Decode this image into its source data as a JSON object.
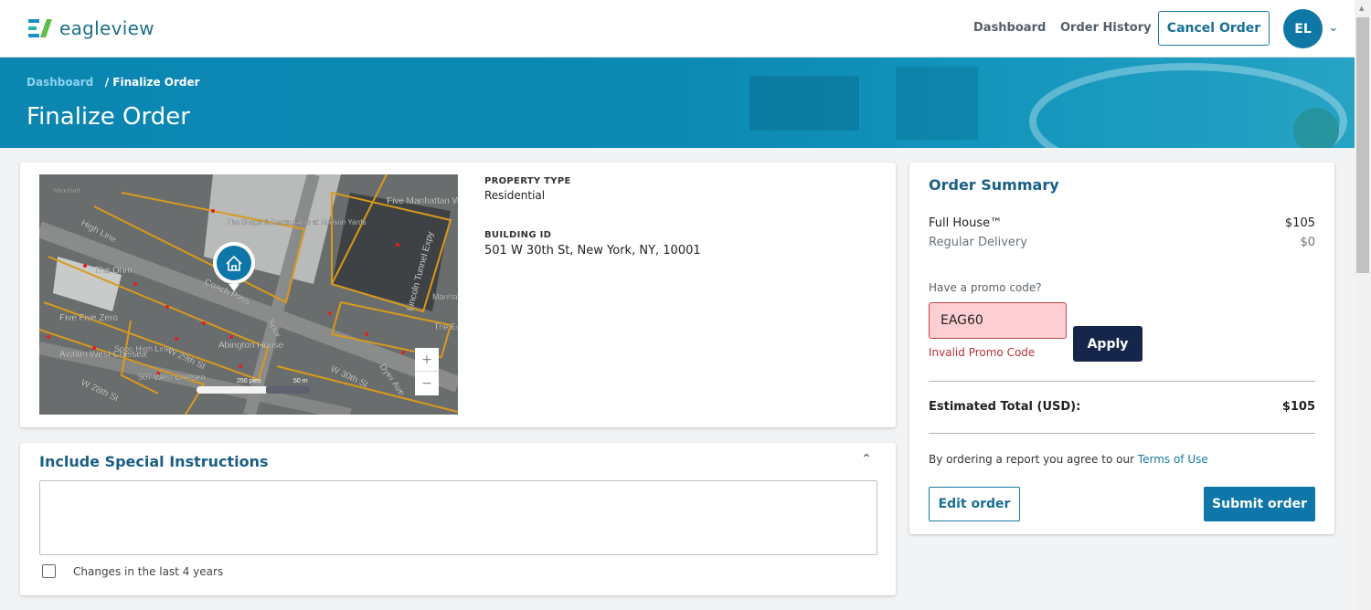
{
  "header": {
    "logo_text": "eagleview",
    "nav": [
      "Dashboard",
      "Order History"
    ],
    "cancel_label": "Cancel Order",
    "avatar_initials": "EL"
  },
  "banner": {
    "breadcrumb": {
      "root": "Dashboard",
      "current": "Finalize Order"
    },
    "title": "Finalize Order"
  },
  "property": {
    "type_label": "PROPERTY TYPE",
    "type_value": "Residential",
    "building_label": "BUILDING ID",
    "building_value": "501 W 30th St, New York, NY, 10001"
  },
  "map": {
    "labels": [
      "High Line",
      "The Shops & Restaurants at Hudson Yards",
      "Five Manhattan West",
      "The Ohm",
      "Coach Pass",
      "Spur",
      "Lincoln Tunnel Expy",
      "Five Five Zero",
      "Avalon West Chelsea",
      "Soori High Line",
      "W 29th St",
      "Abington House",
      "507 West Chelsea",
      "W 30th St",
      "Dyer Ave",
      "W 28th St",
      "Manhattan West",
      "The Eugene"
    ],
    "scale_feet": "250 pies",
    "scale_m": "50 m",
    "zoom_in": "+",
    "zoom_out": "−",
    "attribution": "Microsoft"
  },
  "instructions": {
    "title": "Include Special Instructions",
    "textarea_value": "",
    "checkbox_label": "Changes in the last 4 years",
    "checkbox_checked": false
  },
  "summary": {
    "title": "Order Summary",
    "items": [
      {
        "name": "Full House™",
        "price": "$105"
      },
      {
        "name": "Regular Delivery",
        "price": "$0"
      }
    ],
    "promo_label": "Have a promo code?",
    "promo_value": "EAG60",
    "promo_error": "Invalid Promo Code",
    "apply_label": "Apply",
    "total_label": "Estimated Total (USD):",
    "total_value": "$105",
    "terms_text": "By ordering a report you agree to our ",
    "terms_link": "Terms of Use",
    "edit_label": "Edit order",
    "submit_label": "Submit order"
  },
  "colors": {
    "brand": "#0b86b0",
    "error": "#c5464c",
    "navy": "#16254a"
  }
}
